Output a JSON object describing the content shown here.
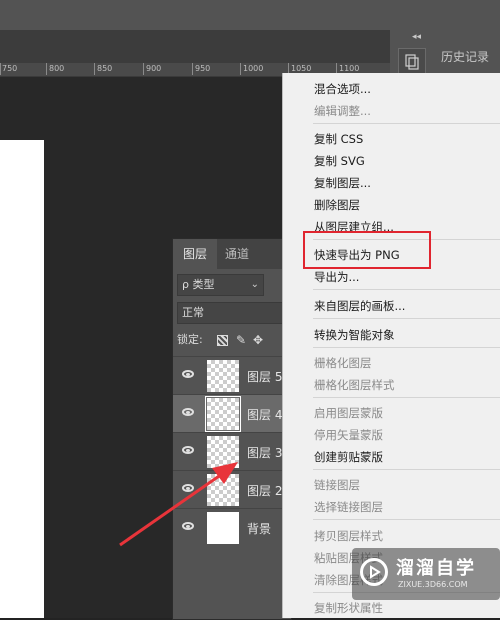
{
  "ruler": {
    "ticks": [
      "750",
      "800",
      "850",
      "900",
      "950",
      "1000",
      "1050",
      "1100"
    ]
  },
  "dock": {
    "collapse_glyph": "◂◂",
    "history_tab_label": "历史记录"
  },
  "layers_panel": {
    "tabs": [
      "图层",
      "通道"
    ],
    "kind_filter": "ρ 类型",
    "blend_mode": "正常",
    "lock_label": "锁定:",
    "layers": [
      {
        "name": "图层 5",
        "thumb": "transparent"
      },
      {
        "name": "图层 4",
        "thumb": "transparent"
      },
      {
        "name": "图层 3",
        "thumb": "transparent"
      },
      {
        "name": "图层 2",
        "thumb": "transparent"
      },
      {
        "name": "背景",
        "thumb": "white"
      }
    ]
  },
  "context_menu": {
    "items": [
      {
        "label": "混合选项...",
        "enabled": true
      },
      {
        "label": "编辑调整...",
        "enabled": false
      },
      {
        "label": "复制 CSS",
        "enabled": true
      },
      {
        "label": "复制 SVG",
        "enabled": true
      },
      {
        "label": "复制图层...",
        "enabled": true
      },
      {
        "label": "删除图层",
        "enabled": true
      },
      {
        "label": "从图层建立组...",
        "enabled": true
      },
      {
        "label": "快速导出为 PNG",
        "enabled": true,
        "highlighted": true
      },
      {
        "label": "导出为...",
        "enabled": true
      },
      {
        "label": "来自图层的画板...",
        "enabled": true
      },
      {
        "label": "转换为智能对象",
        "enabled": true
      },
      {
        "label": "栅格化图层",
        "enabled": false
      },
      {
        "label": "栅格化图层样式",
        "enabled": false
      },
      {
        "label": "启用图层蒙版",
        "enabled": false
      },
      {
        "label": "停用矢量蒙版",
        "enabled": false
      },
      {
        "label": "创建剪贴蒙版",
        "enabled": true
      },
      {
        "label": "链接图层",
        "enabled": false
      },
      {
        "label": "选择链接图层",
        "enabled": false
      },
      {
        "label": "拷贝图层样式",
        "enabled": false
      },
      {
        "label": "粘贴图层样式",
        "enabled": false
      },
      {
        "label": "清除图层样式",
        "enabled": false
      },
      {
        "label": "复制形状属性",
        "enabled": false
      }
    ]
  },
  "watermark": {
    "title": "溜溜自学",
    "subtitle": "ZIXUE.3D66.COM"
  },
  "colors": {
    "highlight": "#e0252f",
    "arrow": "#e8343a",
    "panel": "#535353",
    "menu_bg": "#f0f0f0"
  }
}
